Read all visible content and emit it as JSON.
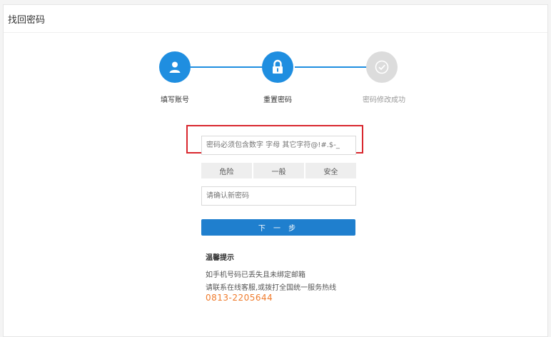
{
  "page": {
    "title": "找回密码"
  },
  "steps": [
    {
      "label": "填写账号",
      "icon": "user-icon",
      "state": "done"
    },
    {
      "label": "重置密码",
      "icon": "lock-icon",
      "state": "active"
    },
    {
      "label": "密码修改成功",
      "icon": "check-circle-icon",
      "state": "pending"
    }
  ],
  "form": {
    "new_password_placeholder": "密码必须包含数字 字母 其它字符@!#.$-_",
    "strength": [
      "危险",
      "一般",
      "安全"
    ],
    "confirm_password_placeholder": "请确认新密码",
    "next_label": "下 一 步"
  },
  "tips": {
    "title": "温馨提示",
    "line1": "如手机号码已丢失且未绑定邮箱",
    "line2": "请联系在线客服,或拨打全国统一服务热线",
    "phone": "0813-2205644"
  },
  "colors": {
    "primary": "#1f8ee0",
    "button": "#1f7fce",
    "pending": "#dcdcdc",
    "highlight": "#d9272e",
    "phone": "#ef7b2c"
  }
}
